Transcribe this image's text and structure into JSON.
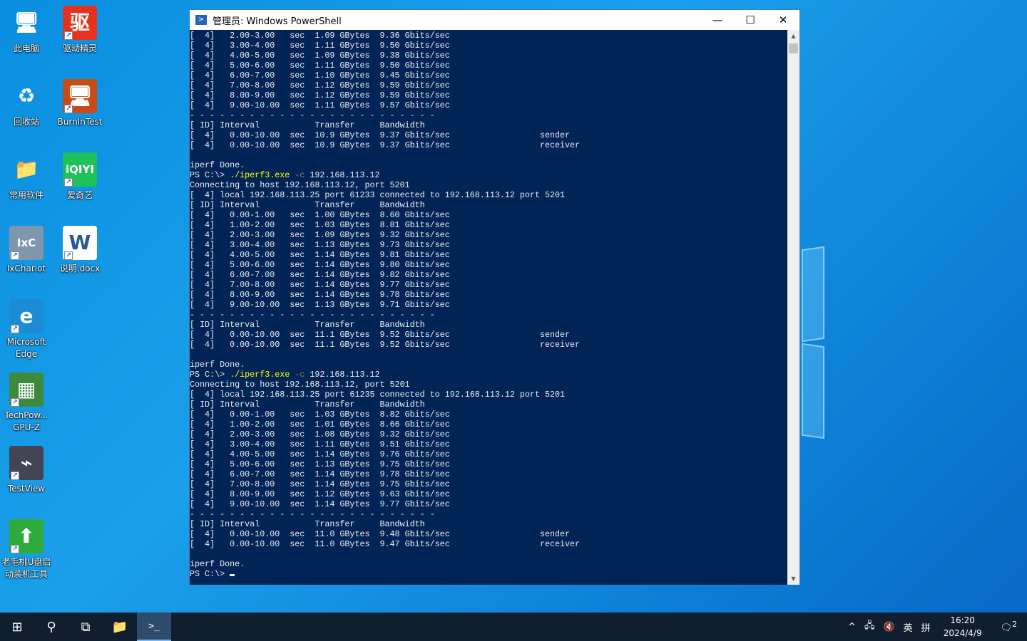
{
  "desktop": {
    "icons": [
      {
        "label": "此电脑",
        "glyph": "🖥",
        "bg": "transparent"
      },
      {
        "label": "驱动精灵",
        "glyph": "驱",
        "bg": "#e7321b"
      },
      {
        "label": "回收站",
        "glyph": "♻",
        "bg": "transparent"
      },
      {
        "label": "BurnInTest",
        "glyph": "🖥",
        "bg": "#c84a16"
      },
      {
        "label": "常用软件",
        "glyph": "📁",
        "bg": "transparent"
      },
      {
        "label": "爱奇艺",
        "glyph": "iQIYI",
        "bg": "#1fc25a"
      },
      {
        "label": "IxChariot",
        "glyph": "IxC",
        "bg": "#7f97ad"
      },
      {
        "label": "说明.docx",
        "glyph": "W",
        "bg": "#ffffff"
      },
      {
        "label": "Microsoft Edge",
        "glyph": "e",
        "bg": "#1b8bd3"
      },
      {
        "label": "TechPow... GPU-Z",
        "glyph": "▦",
        "bg": "#3d8a3d"
      },
      {
        "label": "TestView",
        "glyph": "⌁",
        "bg": "#445"
      },
      {
        "label": "老毛桃U盘启动装机工具",
        "glyph": "⬆",
        "bg": "#2eab3a"
      }
    ]
  },
  "window": {
    "title": "管理员: Windows PowerShell",
    "minimize": "—",
    "maximize": "☐",
    "close": "✕"
  },
  "terminal": {
    "lines": [
      "[  4]   2.00-3.00   sec  1.09 GBytes  9.36 Gbits/sec",
      "[  4]   3.00-4.00   sec  1.11 GBytes  9.50 Gbits/sec",
      "[  4]   4.00-5.00   sec  1.09 GBytes  9.38 Gbits/sec",
      "[  4]   5.00-6.00   sec  1.11 GBytes  9.50 Gbits/sec",
      "[  4]   6.00-7.00   sec  1.10 GBytes  9.45 Gbits/sec",
      "[  4]   7.00-8.00   sec  1.12 GBytes  9.59 Gbits/sec",
      "[  4]   8.00-9.00   sec  1.12 GBytes  9.59 Gbits/sec",
      "[  4]   9.00-10.00  sec  1.11 GBytes  9.57 Gbits/sec",
      "- - - - - - - - - - - - - - - - - - - - - - - - -",
      "[ ID] Interval           Transfer     Bandwidth",
      "[  4]   0.00-10.00  sec  10.9 GBytes  9.37 Gbits/sec                  sender",
      "[  4]   0.00-10.00  sec  10.9 GBytes  9.37 Gbits/sec                  receiver",
      "",
      "iperf Done.",
      {
        "prompt": "PS C:\\> ",
        "cmd": "./iperf3.exe",
        "flag": " -c",
        "arg": " 192.168.113.12"
      },
      "Connecting to host 192.168.113.12, port 5201",
      "[  4] local 192.168.113.25 port 61233 connected to 192.168.113.12 port 5201",
      "[ ID] Interval           Transfer     Bandwidth",
      "[  4]   0.00-1.00   sec  1.00 GBytes  8.60 Gbits/sec",
      "[  4]   1.00-2.00   sec  1.03 GBytes  8.81 Gbits/sec",
      "[  4]   2.00-3.00   sec  1.09 GBytes  9.32 Gbits/sec",
      "[  4]   3.00-4.00   sec  1.13 GBytes  9.73 Gbits/sec",
      "[  4]   4.00-5.00   sec  1.14 GBytes  9.81 Gbits/sec",
      "[  4]   5.00-6.00   sec  1.14 GBytes  9.80 Gbits/sec",
      "[  4]   6.00-7.00   sec  1.14 GBytes  9.82 Gbits/sec",
      "[  4]   7.00-8.00   sec  1.14 GBytes  9.77 Gbits/sec",
      "[  4]   8.00-9.00   sec  1.14 GBytes  9.78 Gbits/sec",
      "[  4]   9.00-10.00  sec  1.13 GBytes  9.71 Gbits/sec",
      "- - - - - - - - - - - - - - - - - - - - - - - - -",
      "[ ID] Interval           Transfer     Bandwidth",
      "[  4]   0.00-10.00  sec  11.1 GBytes  9.52 Gbits/sec                  sender",
      "[  4]   0.00-10.00  sec  11.1 GBytes  9.52 Gbits/sec                  receiver",
      "",
      "iperf Done.",
      {
        "prompt": "PS C:\\> ",
        "cmd": "./iperf3.exe",
        "flag": " -c",
        "arg": " 192.168.113.12"
      },
      "Connecting to host 192.168.113.12, port 5201",
      "[  4] local 192.168.113.25 port 61235 connected to 192.168.113.12 port 5201",
      "[ ID] Interval           Transfer     Bandwidth",
      "[  4]   0.00-1.00   sec  1.03 GBytes  8.82 Gbits/sec",
      "[  4]   1.00-2.00   sec  1.01 GBytes  8.66 Gbits/sec",
      "[  4]   2.00-3.00   sec  1.08 GBytes  9.32 Gbits/sec",
      "[  4]   3.00-4.00   sec  1.11 GBytes  9.51 Gbits/sec",
      "[  4]   4.00-5.00   sec  1.14 GBytes  9.76 Gbits/sec",
      "[  4]   5.00-6.00   sec  1.13 GBytes  9.75 Gbits/sec",
      "[  4]   6.00-7.00   sec  1.14 GBytes  9.78 Gbits/sec",
      "[  4]   7.00-8.00   sec  1.14 GBytes  9.75 Gbits/sec",
      "[  4]   8.00-9.00   sec  1.12 GBytes  9.63 Gbits/sec",
      "[  4]   9.00-10.00  sec  1.14 GBytes  9.77 Gbits/sec",
      "- - - - - - - - - - - - - - - - - - - - - - - - -",
      "[ ID] Interval           Transfer     Bandwidth",
      "[  4]   0.00-10.00  sec  11.0 GBytes  9.48 Gbits/sec                  sender",
      "[  4]   0.00-10.00  sec  11.0 GBytes  9.47 Gbits/sec                  receiver",
      "",
      "iperf Done.",
      "PS C:\\> "
    ]
  },
  "taskbar": {
    "start": "⊞",
    "search": "⚲",
    "taskview": "⧉",
    "explorer": "📁",
    "powershell": ">_"
  },
  "tray": {
    "chevron": "^",
    "network": "🖧",
    "volume": "🔇",
    "ime_lang": "英",
    "ime_mode": "拼",
    "time": "16:20",
    "date": "2024/4/9",
    "notifications": "2"
  }
}
